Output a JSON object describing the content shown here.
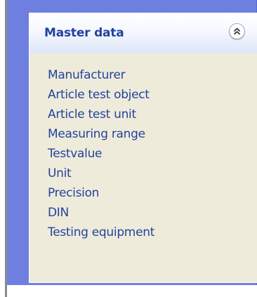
{
  "panel": {
    "title": "Master data",
    "collapse_icon": "double-chevron-up-icon",
    "items": [
      {
        "label": "Manufacturer"
      },
      {
        "label": "Article test object"
      },
      {
        "label": "Article test unit"
      },
      {
        "label": "Measuring range"
      },
      {
        "label": "Testvalue"
      },
      {
        "label": "Unit"
      },
      {
        "label": "Precision"
      },
      {
        "label": "DIN"
      },
      {
        "label": "Testing equipment"
      }
    ]
  },
  "colors": {
    "panel_background": "#6e7fe0",
    "group_background": "#efebdb",
    "link_text": "#21449c",
    "header_gradient_end": "#dde5f8"
  }
}
